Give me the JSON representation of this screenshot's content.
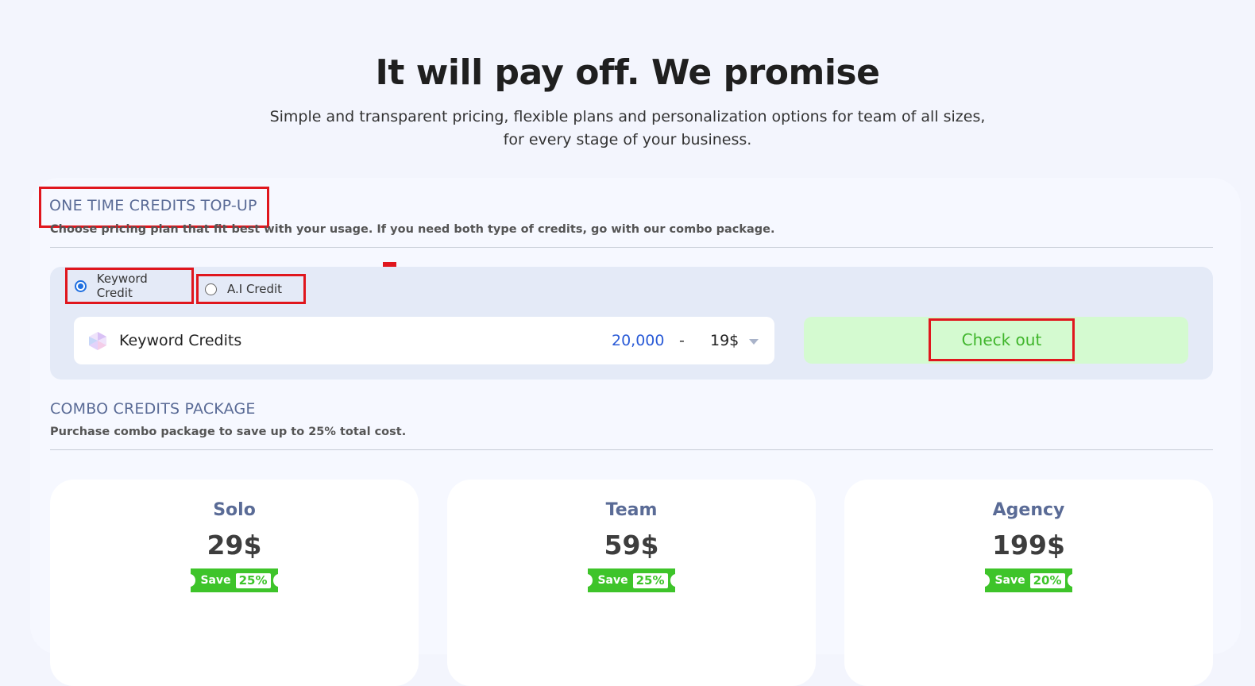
{
  "hero": {
    "title": "It will pay off. We promise",
    "subtitle_line1": "Simple and transparent pricing, flexible plans and personalization options for team of all sizes,",
    "subtitle_line2": "for every stage of your business."
  },
  "topup": {
    "title": "ONE TIME CREDITS TOP-UP",
    "subtitle": "Choose pricing plan that fit best with your usage. If you need both type of credits, go with our combo package.",
    "options": [
      {
        "label": "Keyword Credit",
        "selected": true
      },
      {
        "label": "A.I Credit",
        "selected": false
      }
    ],
    "selector": {
      "label": "Keyword Credits",
      "amount": "20,000",
      "dash": "-",
      "price": "19$"
    },
    "checkout_label": "Check out"
  },
  "combo": {
    "title": "COMBO CREDITS PACKAGE",
    "subtitle": "Purchase combo package to save up to 25% total cost.",
    "plans": [
      {
        "name": "Solo",
        "price": "29$",
        "save_label": "Save",
        "save_pct": "25%"
      },
      {
        "name": "Team",
        "price": "59$",
        "save_label": "Save",
        "save_pct": "25%"
      },
      {
        "name": "Agency",
        "price": "199$",
        "save_label": "Save",
        "save_pct": "20%"
      }
    ]
  },
  "colors": {
    "accent": "#5a6b96",
    "checkout_bg": "#d4fad0",
    "checkout_text": "#3fb52b",
    "save_badge": "#3ec42a",
    "highlight": "#e0161d"
  }
}
